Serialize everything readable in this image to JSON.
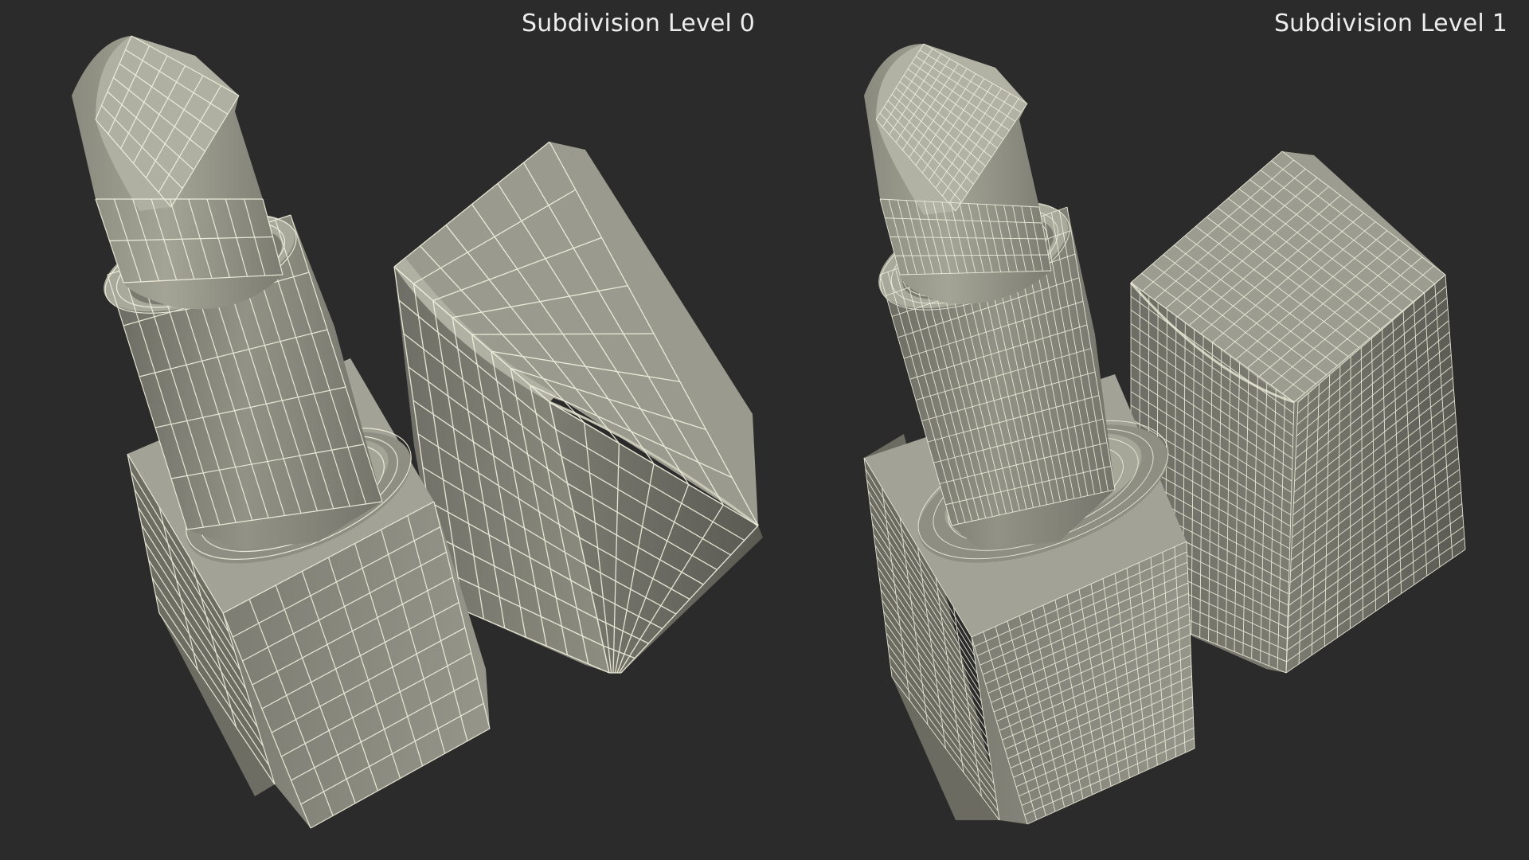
{
  "panels": [
    {
      "label": "Subdivision Level 0",
      "mesh_density": "coarse"
    },
    {
      "label": "Subdivision Level 1",
      "mesh_density": "fine"
    }
  ],
  "colors": {
    "background": "#2b2b2b",
    "surface": "#8c8c80",
    "surface_shadow": "#5e5e56",
    "surface_light": "#a5a597",
    "wire": "#f4f2df",
    "caption": "#ededed"
  },
  "icons": {
    "lipstick_bullet": "lipstick-bullet-icon",
    "lipstick_cap": "lipstick-cap-icon"
  }
}
